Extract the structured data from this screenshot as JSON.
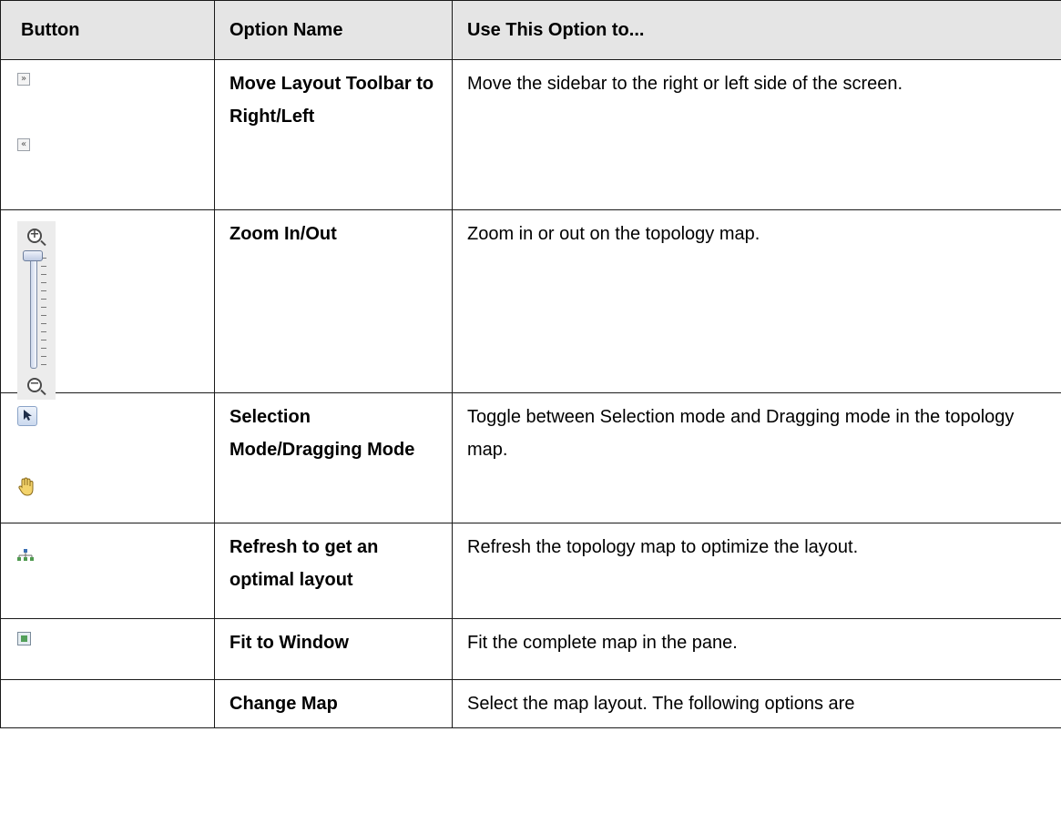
{
  "header": {
    "col_button": "Button",
    "col_option": "Option Name",
    "col_use": "Use This Option to..."
  },
  "rows": [
    {
      "option": "Move Layout Toolbar to Right/Left",
      "description": "Move the sidebar to the right or left side of the screen.",
      "icons": [
        "double-right-arrow-icon",
        "double-left-arrow-icon"
      ]
    },
    {
      "option": "Zoom In/Out",
      "description": "Zoom in or out on the topology map.",
      "icons": [
        "zoom-in-icon",
        "zoom-slider",
        "zoom-out-icon"
      ]
    },
    {
      "option": "Selection Mode/Dragging Mode",
      "description": "Toggle between Selection mode and Dragging mode in the topology map.",
      "icons": [
        "selection-arrow-icon",
        "hand-drag-icon"
      ]
    },
    {
      "option": "Refresh to get an optimal layout",
      "description": "Refresh the topology map to optimize the layout.",
      "icons": [
        "tree-layout-icon"
      ]
    },
    {
      "option": "Fit to Window",
      "description": "Fit the complete map in the pane.",
      "icons": [
        "fit-to-window-icon"
      ]
    },
    {
      "option": "Change Map",
      "description": "Select the map layout. The following options are",
      "icons": []
    }
  ]
}
